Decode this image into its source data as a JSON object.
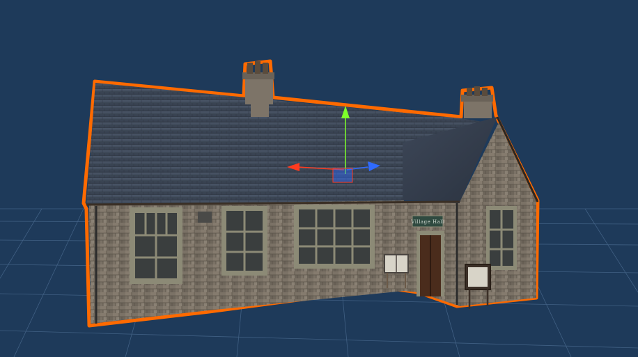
{
  "scene": {
    "background_color": "#1e3a5a",
    "grid_color": "#5d7fa6",
    "selection_outline_color": "#ff6a00",
    "object_type": "stone building (village hall) 3D model",
    "sign_text": "Village Hall"
  },
  "gizmo": {
    "type": "move-gizmo",
    "x_axis_color": "#ff3b1f",
    "y_axis_color": "#7dff2a",
    "z_axis_color": "#2f6bff"
  }
}
